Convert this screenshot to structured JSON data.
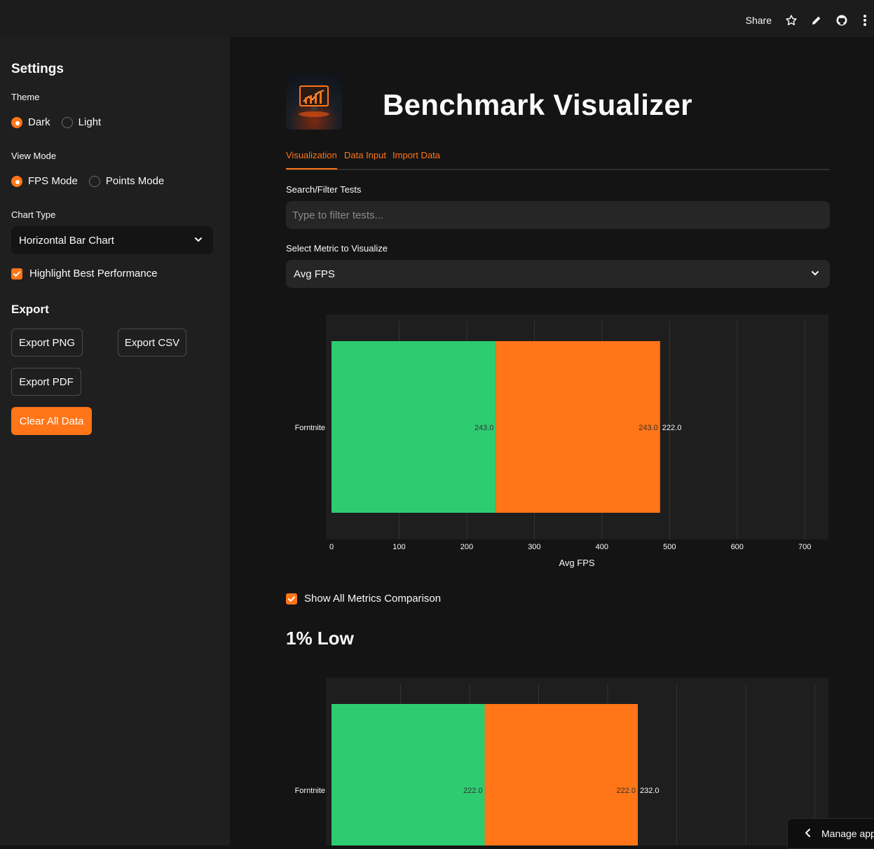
{
  "header": {
    "share_label": "Share",
    "icons": [
      "star-icon",
      "edit-icon",
      "github-icon",
      "more-icon"
    ]
  },
  "sidebar": {
    "title": "Settings",
    "theme": {
      "label": "Theme",
      "options": [
        "Dark",
        "Light"
      ],
      "selected": "Dark"
    },
    "view_mode": {
      "label": "View Mode",
      "options": [
        "FPS Mode",
        "Points Mode"
      ],
      "selected": "FPS Mode"
    },
    "chart_type": {
      "label": "Chart Type",
      "value": "Horizontal Bar Chart"
    },
    "highlight": {
      "label": "Highlight Best Performance",
      "checked": true
    },
    "export": {
      "title": "Export",
      "png_label": "Export PNG",
      "csv_label": "Export CSV",
      "pdf_label": "Export PDF",
      "clear_label": "Clear All Data"
    }
  },
  "main": {
    "title": "Benchmark Visualizer",
    "tabs": [
      "Visualization",
      "Data Input",
      "Import Data"
    ],
    "active_tab": "Visualization",
    "search": {
      "label": "Search/Filter Tests",
      "placeholder": "Type to filter tests...",
      "value": ""
    },
    "metric": {
      "label": "Select Metric to Visualize",
      "value": "Avg FPS"
    },
    "show_all": {
      "label": "Show All Metrics Comparison",
      "checked": true
    },
    "section_title": "1% Low"
  },
  "colors": {
    "accent": "#ff7518",
    "best": "#2ecc71",
    "bar": "#ff7518"
  },
  "chart_data": [
    {
      "type": "bar",
      "orientation": "horizontal",
      "barmode": "stack",
      "categories": [
        "Forntnite"
      ],
      "series": [
        {
          "values": [
            243.0
          ],
          "labels": [
            "243.0"
          ],
          "color": "#2ecc71"
        },
        {
          "values": [
            243.0
          ],
          "labels": [
            "243.0"
          ],
          "color": "#ff7518"
        },
        {
          "values": [
            222.0
          ],
          "labels": [
            "222.0"
          ],
          "color": "#ff7518"
        }
      ],
      "xlabel": "Avg FPS",
      "xticks": [
        0,
        100,
        200,
        300,
        400,
        500,
        600,
        700
      ],
      "xlim": [
        0,
        734
      ],
      "grid": true
    },
    {
      "type": "bar",
      "orientation": "horizontal",
      "barmode": "stack",
      "categories": [
        "Forntnite"
      ],
      "series": [
        {
          "values": [
            222.0
          ],
          "labels": [
            "222.0"
          ],
          "color": "#2ecc71"
        },
        {
          "values": [
            222.0
          ],
          "labels": [
            "222.0"
          ],
          "color": "#ff7518"
        },
        {
          "values": [
            232.0
          ],
          "labels": [
            "232.0"
          ],
          "color": "#ff7518"
        }
      ],
      "xlabel": "",
      "xticks": [],
      "xlim": [
        0,
        700
      ],
      "grid": true
    }
  ],
  "manage_app_label": "Manage app"
}
